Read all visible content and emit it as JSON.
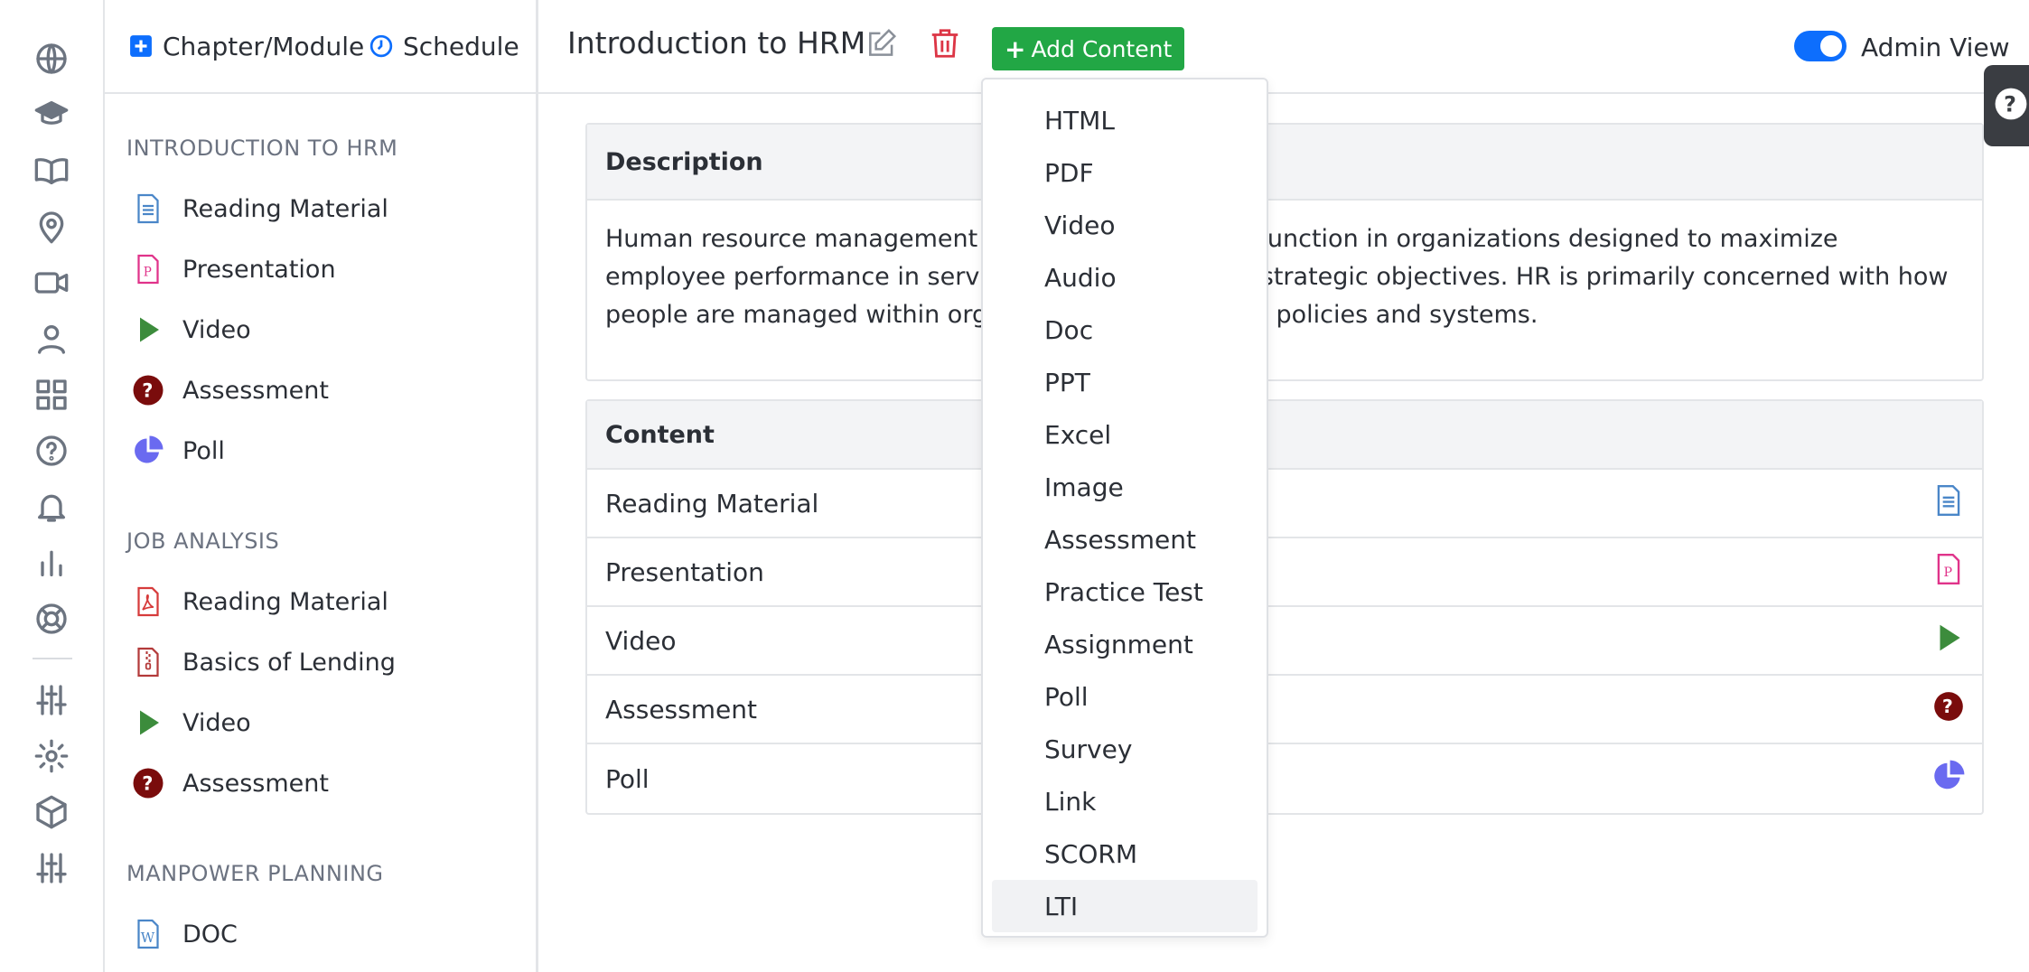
{
  "nav": {
    "chapter_module_label": "Chapter/Module",
    "schedule_label": "Schedule"
  },
  "chapters": [
    {
      "title": "INTRODUCTION TO HRM",
      "items": [
        {
          "label": "Reading Material",
          "icon": "document-icon"
        },
        {
          "label": "Presentation",
          "icon": "presentation-icon"
        },
        {
          "label": "Video",
          "icon": "play-icon"
        },
        {
          "label": "Assessment",
          "icon": "question-icon"
        },
        {
          "label": "Poll",
          "icon": "pie-chart-icon"
        }
      ]
    },
    {
      "title": "JOB ANALYSIS",
      "items": [
        {
          "label": "Reading Material",
          "icon": "pdf-icon"
        },
        {
          "label": "Basics of Lending",
          "icon": "zip-file-icon"
        },
        {
          "label": "Video",
          "icon": "play-icon"
        },
        {
          "label": "Assessment",
          "icon": "question-icon"
        }
      ]
    },
    {
      "title": "MANPOWER PLANNING",
      "items": [
        {
          "label": "DOC",
          "icon": "word-file-icon"
        }
      ]
    }
  ],
  "header": {
    "title": "Introduction to HRM",
    "add_content_label": "Add Content",
    "admin_view_label": "Admin View",
    "admin_view_on": true
  },
  "description": {
    "heading": "Description",
    "text": "Human resource management (HRM) is the strategic function in organizations designed to maximize employee performance in service of their employer's strategic objectives. HR is primarily concerned with how people are managed within organizations, focusing on policies and systems."
  },
  "content": {
    "heading": "Content",
    "rows": [
      {
        "label": "Reading Material",
        "icon": "document-icon"
      },
      {
        "label": "Presentation",
        "icon": "presentation-icon"
      },
      {
        "label": "Video",
        "icon": "play-icon"
      },
      {
        "label": "Assessment",
        "icon": "question-icon"
      },
      {
        "label": "Poll",
        "icon": "pie-chart-icon"
      }
    ]
  },
  "add_content_menu": {
    "items": [
      "HTML",
      "PDF",
      "Video",
      "Audio",
      "Doc",
      "PPT",
      "Excel",
      "Image",
      "Assessment",
      "Practice Test",
      "Assignment",
      "Poll",
      "Survey",
      "Link",
      "SCORM",
      "LTI"
    ],
    "highlighted": "LTI"
  },
  "colors": {
    "accent_blue": "#0d6efd",
    "add_green": "#22a745",
    "delete_red": "#dc3545",
    "doc_blue": "#4a86c8",
    "ppt_pink": "#e0338a",
    "play_green": "#3c8c3c",
    "assess_maroon": "#7a0c0c",
    "poll_purple": "#6a6af0"
  }
}
